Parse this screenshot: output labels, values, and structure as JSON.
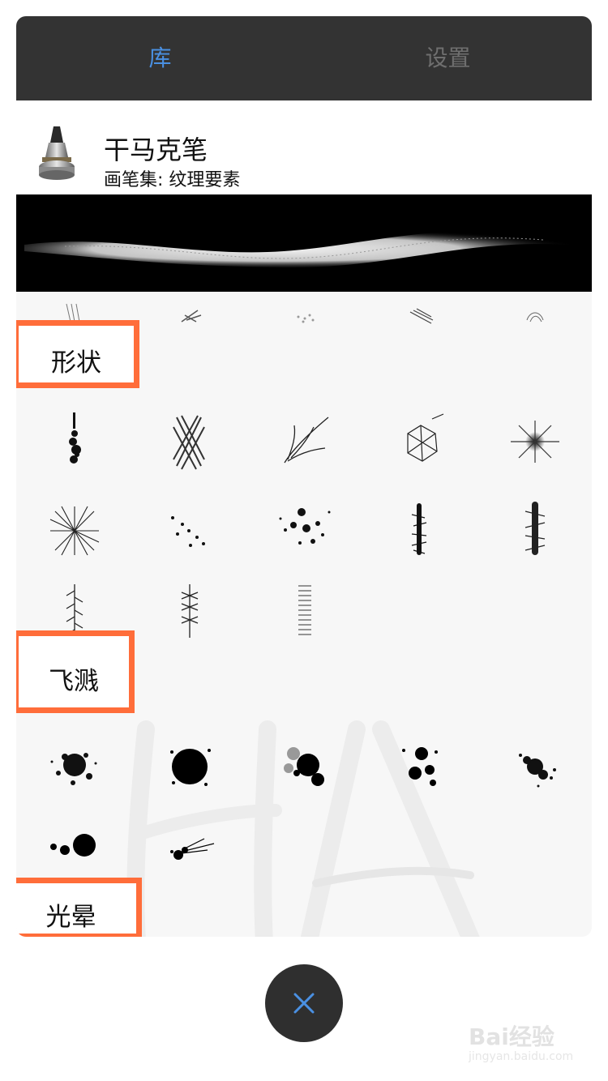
{
  "tabs": {
    "library": "库",
    "settings": "设置"
  },
  "brush": {
    "name": "干马克笔",
    "set": "画笔集: 纹理要素"
  },
  "sections": {
    "shapes": "形状",
    "splatter": "飞溅",
    "halo": "光晕"
  },
  "colors": {
    "accent": "#4a90e2",
    "highlight": "#ff6d3a",
    "tab_bg": "#333333",
    "close_bg": "#2f2f2f"
  },
  "icons": {
    "close": "close-icon"
  },
  "watermark": {
    "brand": "Bai",
    "brand_cn": "经验",
    "url": "jingyan.baidu.com"
  }
}
